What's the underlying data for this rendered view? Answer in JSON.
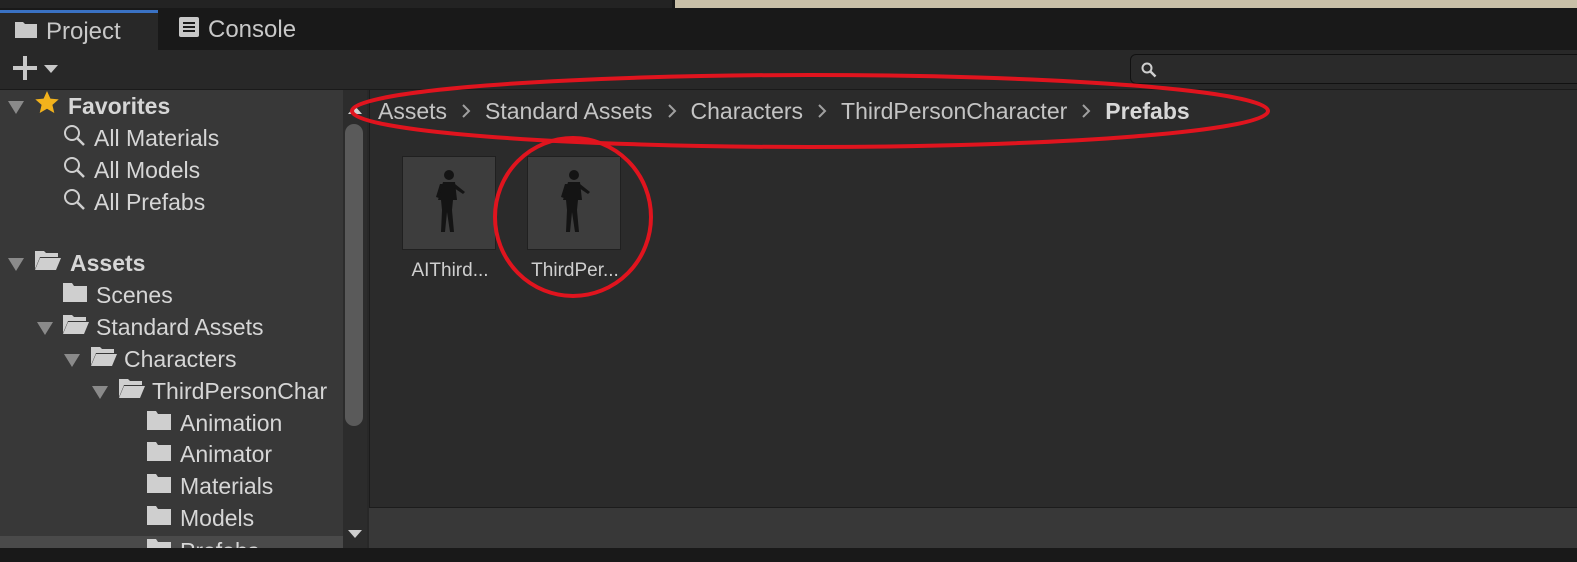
{
  "tabs": [
    {
      "label": "Project",
      "icon": "folder-icon",
      "active": true
    },
    {
      "label": "Console",
      "icon": "console-icon",
      "active": false
    }
  ],
  "toolbar": {
    "add_icon": "plus-icon",
    "search_icon": "search-icon",
    "search_value": ""
  },
  "sidebar": {
    "favorites": {
      "label": "Favorites",
      "items": [
        "All Materials",
        "All Models",
        "All Prefabs"
      ]
    },
    "assets": {
      "label": "Assets",
      "items": [
        "Scenes",
        "Standard Assets",
        "Characters",
        "ThirdPersonChar",
        "Animation",
        "Animator",
        "Materials",
        "Models",
        "Prefabs"
      ]
    }
  },
  "breadcrumb": [
    "Assets",
    "Standard Assets",
    "Characters",
    "ThirdPersonCharacter",
    "Prefabs"
  ],
  "assets": [
    {
      "label": "AIThird..."
    },
    {
      "label": "ThirdPer..."
    }
  ],
  "colors": {
    "accent": "#3a72c4",
    "annotation": "#e0141e",
    "favorite_star": "#f2b21c"
  }
}
